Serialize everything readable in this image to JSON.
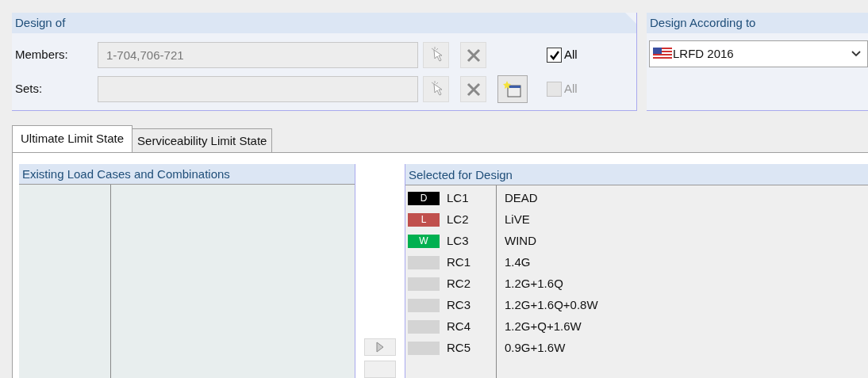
{
  "design_of": {
    "title": "Design of",
    "members": {
      "label": "Members:",
      "value": "1-704,706-721",
      "all": {
        "label": "All",
        "checked": true,
        "disabled": false
      }
    },
    "sets": {
      "label": "Sets:",
      "all": {
        "label": "All",
        "checked": false,
        "disabled": true
      }
    }
  },
  "design_according_to": {
    "title": "Design According to",
    "standard": "LRFD 2016"
  },
  "tabs": [
    {
      "label": "Ultimate Limit State",
      "selected": true
    },
    {
      "label": "Serviceability Limit State",
      "selected": false
    }
  ],
  "existing": {
    "title": "Existing Load Cases and Combinations"
  },
  "selected_for_design": {
    "title": "Selected for Design",
    "rows": [
      {
        "badge": "D",
        "color": "#000000",
        "id": "LC1",
        "description": "DEAD"
      },
      {
        "badge": "L",
        "color": "#c0504d",
        "id": "LC2",
        "description": "LiVE"
      },
      {
        "badge": "W",
        "color": "#00b050",
        "id": "LC3",
        "description": "WIND"
      },
      {
        "color": "#d4d4d4",
        "id": "RC1",
        "description": "1.4G"
      },
      {
        "color": "#d4d4d4",
        "id": "RC2",
        "description": "1.2G+1.6Q"
      },
      {
        "color": "#d4d4d4",
        "id": "RC3",
        "description": "1.2G+1.6Q+0.8W"
      },
      {
        "color": "#d4d4d4",
        "id": "RC4",
        "description": "1.2G+Q+1.6W"
      },
      {
        "color": "#d4d4d4",
        "id": "RC5",
        "description": "0.9G+1.6W"
      }
    ]
  }
}
